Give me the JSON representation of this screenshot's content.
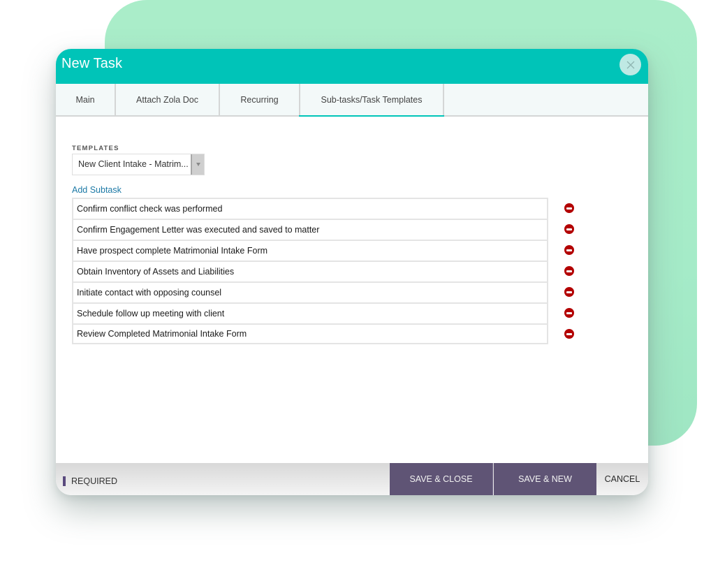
{
  "colors": {
    "header_bg": "#00c4b8",
    "accent_green_bg": "#a8ecc8",
    "primary_button": "#5f5475",
    "remove_icon": "#b30000",
    "link": "#1c79a6"
  },
  "modal": {
    "title": "New Task",
    "close_icon": "close-icon"
  },
  "tabs": [
    {
      "label": "Main",
      "active": false
    },
    {
      "label": "Attach Zola Doc",
      "active": false
    },
    {
      "label": "Recurring",
      "active": false
    },
    {
      "label": "Sub-tasks/Task Templates",
      "active": true
    }
  ],
  "templates": {
    "label": "TEMPLATES",
    "selected": "New Client Intake - Matrim..."
  },
  "add_subtask_label": "Add Subtask",
  "subtasks": [
    "Confirm conflict check was performed",
    "Confirm Engagement Letter was executed and saved to matter",
    "Have prospect complete Matrimonial Intake Form",
    "Obtain Inventory of Assets and Liabilities",
    "Initiate contact with opposing counsel",
    "Schedule follow up meeting with client",
    "Review Completed Matrimonial Intake Form"
  ],
  "footer": {
    "required_label": "REQUIRED",
    "save_close_label": "SAVE & CLOSE",
    "save_new_label": "SAVE & NEW",
    "cancel_label": "CANCEL"
  }
}
